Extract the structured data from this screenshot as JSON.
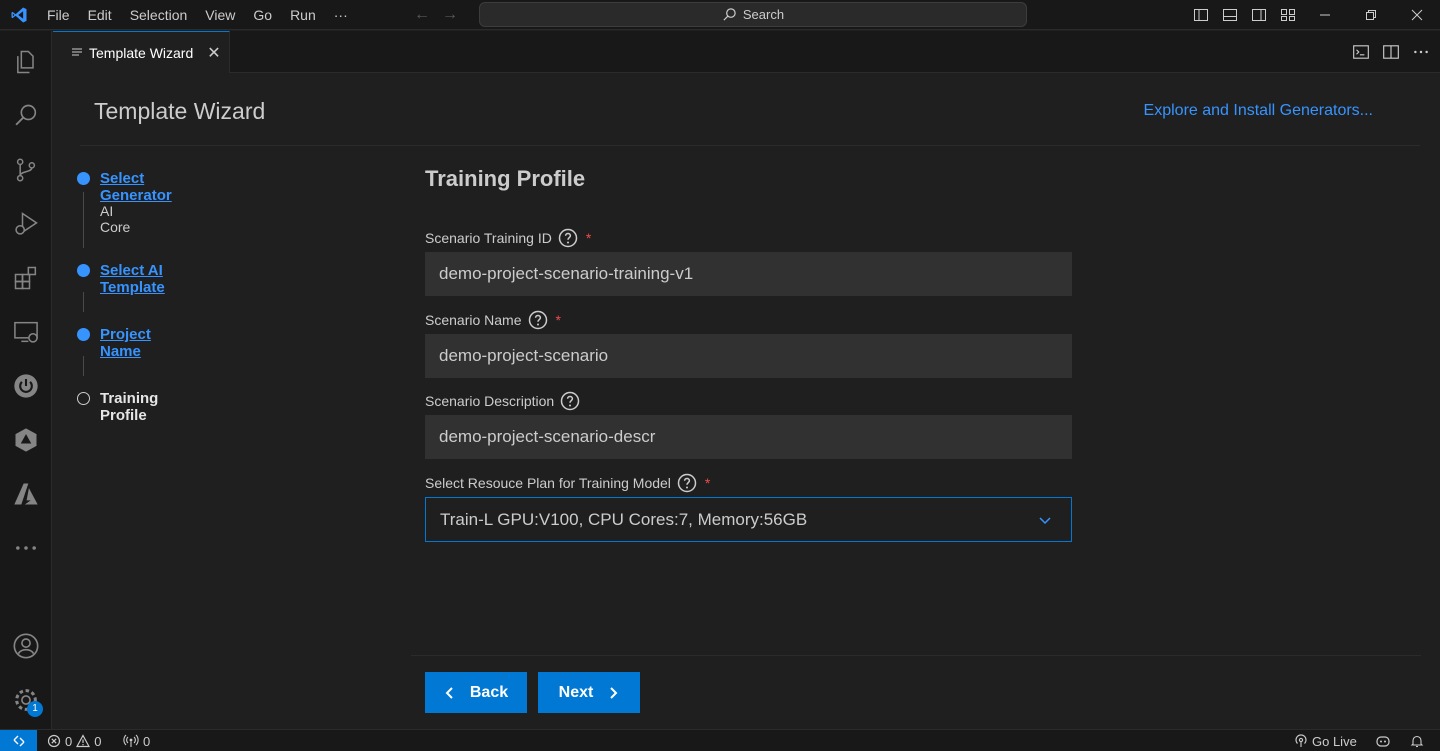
{
  "titlebar": {
    "menu": [
      "File",
      "Edit",
      "Selection",
      "View",
      "Go",
      "Run",
      "···"
    ],
    "search_label": "Search"
  },
  "tab": {
    "label": "Template Wizard"
  },
  "wizard": {
    "title": "Template Wizard",
    "explore_link": "Explore and Install Generators...",
    "steps": [
      {
        "label": "Select Generator",
        "sub": "AI Core"
      },
      {
        "label": "Select AI Template"
      },
      {
        "label": "Project Name"
      },
      {
        "label": "Training Profile"
      }
    ]
  },
  "form": {
    "title": "Training Profile",
    "fields": [
      {
        "label": "Scenario Training ID",
        "required": "*",
        "value": "demo-project-scenario-training-v1"
      },
      {
        "label": "Scenario Name",
        "required": "*",
        "value": "demo-project-scenario"
      },
      {
        "label": "Scenario Description",
        "value": "demo-project-scenario-descr"
      },
      {
        "label": "Select Resouce Plan for Training Model",
        "required": "*",
        "value": "Train-L GPU:V100, CPU Cores:7, Memory:56GB"
      }
    ],
    "back_label": "Back",
    "next_label": "Next"
  },
  "activity": {
    "settings_badge": "1"
  },
  "statusbar": {
    "errors": "0",
    "warnings": "0",
    "ports": "0",
    "go_live": "Go Live"
  },
  "colors": {
    "accent": "#0078d4",
    "link": "#3794ff",
    "required": "#f14c4c"
  }
}
